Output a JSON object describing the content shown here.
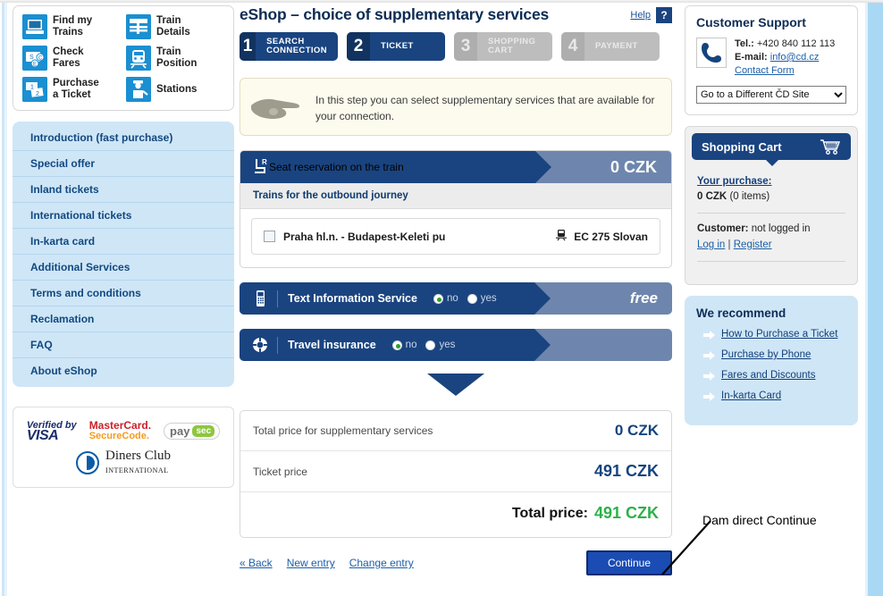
{
  "quicklinks": [
    {
      "label": "Find my\nTrains",
      "icon": "laptop-icon"
    },
    {
      "label": "Train\nDetails",
      "icon": "train-details-icon"
    },
    {
      "label": "Check\nFares",
      "icon": "money-icon"
    },
    {
      "label": "Train\nPosition",
      "icon": "train-front-icon"
    },
    {
      "label": "Purchase\na Ticket",
      "icon": "ticket-icon"
    },
    {
      "label": "Stations",
      "icon": "conductor-icon"
    }
  ],
  "sidebar": {
    "items": [
      "Introduction (fast purchase)",
      "Special offer",
      "Inland tickets",
      "International tickets",
      "In-karta card",
      "Additional Services",
      "Terms and conditions",
      "Reclamation",
      "FAQ",
      "About eShop"
    ]
  },
  "cards": {
    "visa_top": "Verified by",
    "visa_main": "VISA",
    "mc_top": "MasterCard.",
    "mc_bottom": "SecureCode.",
    "paysec_1": "pay",
    "paysec_2": "sec",
    "diners_1": "Diners Club",
    "diners_2": "INTERNATIONAL"
  },
  "header": {
    "title": "eShop – choice of supplementary services",
    "help_label": "Help",
    "help_badge": "?"
  },
  "steps": [
    {
      "num": "1",
      "label": "SEARCH\nCONNECTION",
      "state": "done"
    },
    {
      "num": "2",
      "label": "TICKET",
      "state": "active"
    },
    {
      "num": "3",
      "label": "SHOPPING\nCART",
      "state": "idle"
    },
    {
      "num": "4",
      "label": "PAYMENT",
      "state": "idle"
    }
  ],
  "info": {
    "text": "In this step you can select supplementary services that are available for your connection."
  },
  "seat": {
    "title": "Seat reservation on the train",
    "price": "0 CZK",
    "subtitle": "Trains for the outbound journey",
    "row_label": "Praha hl.n. - Budapest-Keleti pu",
    "train": "EC 275 Slovan",
    "checked": false
  },
  "services": [
    {
      "name": "Text Information Service",
      "icon": "mobile-phone-icon",
      "price": "free",
      "options": [
        {
          "label": "no",
          "selected": true
        },
        {
          "label": "yes",
          "selected": false
        }
      ]
    },
    {
      "name": "Travel insurance",
      "icon": "lifebuoy-icon",
      "price": "",
      "options": [
        {
          "label": "no",
          "selected": true
        },
        {
          "label": "yes",
          "selected": false
        }
      ]
    }
  ],
  "totals": {
    "supplementary_label": "Total price for supplementary services",
    "supplementary_value": "0 CZK",
    "ticket_label": "Ticket price",
    "ticket_value": "491 CZK",
    "total_label": "Total price:",
    "total_value": "491 CZK"
  },
  "bottom": {
    "back": "« Back",
    "new_entry": "New entry",
    "change_entry": "Change entry",
    "continue": "Continue"
  },
  "support": {
    "title": "Customer Support",
    "tel_label": "Tel.:",
    "tel_value": "+420 840 112 113",
    "email_label": "E-mail:",
    "email_value": "info@cd.cz",
    "contact_form": "Contact Form",
    "site_select": "Go to a Different ČD Site"
  },
  "cart": {
    "title": "Shopping Cart",
    "purchase_link": "Your purchase:",
    "amount": "0 CZK",
    "items": "(0 items)",
    "customer_label": "Customer:",
    "customer_value": "not logged in",
    "login": "Log in",
    "separator": "|",
    "register": "Register"
  },
  "recommend": {
    "title": "We recommend",
    "items": [
      "How to Purchase a Ticket",
      "Purchase by Phone",
      "Fares and Discounts",
      "In-karta Card"
    ]
  },
  "annotation": {
    "text": "Dam direct Continue"
  },
  "colors": {
    "brand_dark": "#1a4480",
    "brand_light": "#6e86ad",
    "sidebar_blue": "#cfe6f7",
    "green": "#2cb14a",
    "link": "#1c5fa8"
  }
}
